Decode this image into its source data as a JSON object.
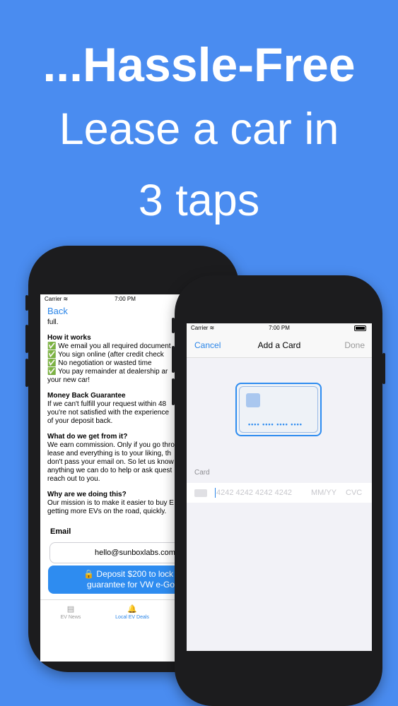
{
  "headline": {
    "line1": "...Hassle-Free",
    "line2": "Lease a car in",
    "line3": "3 taps"
  },
  "left_phone": {
    "status": {
      "carrier": "Carrier",
      "time": "7:00 PM"
    },
    "back_label": "Back",
    "content": {
      "intro_tail": "full.",
      "how_title": "How it works",
      "how_items": [
        "✅ We email you all required document",
        "✅ You sign online (after credit check",
        "✅ No negotiation or wasted time",
        "✅ You pay remainder at dealership ar",
        "your new car!"
      ],
      "guarantee_title": "Money Back Guarantee",
      "guarantee_lines": [
        " If we can't fulfill your request within 48",
        "you're not satisfied with the experience",
        "of your deposit back."
      ],
      "what_title": "What do we get from it?",
      "what_lines": [
        "We earn commission. Only if you go thro",
        "lease and everything is to your liking, th",
        "don't pass your email on. So let us know",
        "anything we can do to help or ask quest",
        "reach out to you."
      ],
      "why_title": "Why are we doing this?",
      "why_lines": [
        "Our mission is to make it easier to buy E",
        "getting more EVs on the road, quickly."
      ]
    },
    "email_label": "Email",
    "email_value": "hello@sunboxlabs.com",
    "deposit_line1": "🔒 Deposit $200 to lock in",
    "deposit_line2": "guarantee for VW e-Golf",
    "tabs": [
      {
        "label": "EV News",
        "icon": "newspaper-icon",
        "glyph": "▤"
      },
      {
        "label": "Local EV Deals",
        "icon": "bell-icon",
        "glyph": "🔔"
      }
    ]
  },
  "right_phone": {
    "status": {
      "carrier": "Carrier",
      "time": "7:00 PM"
    },
    "nav": {
      "cancel": "Cancel",
      "title": "Add a Card",
      "done": "Done"
    },
    "card_dots": "•••• •••• •••• ••••",
    "card_label": "Card",
    "card_number_placeholder": "4242 4242 4242 4242",
    "expiry_placeholder": "MM/YY",
    "cvc_placeholder": "CVC"
  },
  "colors": {
    "background": "#4a8cf0",
    "accent": "#2a85e8",
    "phone_body": "#1c1c1e"
  }
}
